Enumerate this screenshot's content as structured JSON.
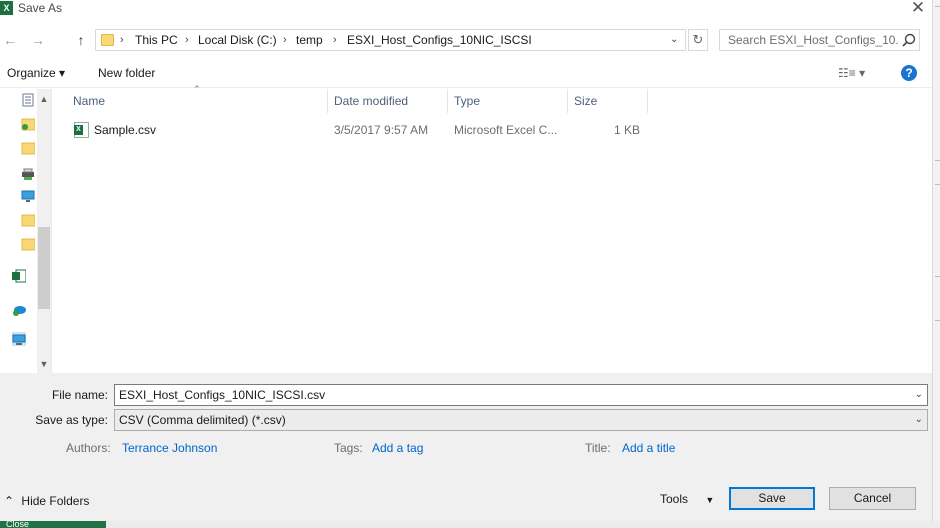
{
  "window": {
    "title": "Save As",
    "app_icon": "excel-icon",
    "close_glyph": "✕"
  },
  "address": {
    "crumbs": [
      "This PC",
      "Local Disk (C:)",
      "temp",
      "ESXI_Host_Configs_10NIC_ISCSI"
    ],
    "separator": "›",
    "dropdown_glyph": "⌄",
    "refresh_glyph": "↻"
  },
  "nav_buttons": {
    "back": "←",
    "forward": "→",
    "up": "↑"
  },
  "search": {
    "placeholder": "Search ESXI_Host_Configs_10..."
  },
  "toolbar": {
    "organize_label": "Organize ▾",
    "new_folder_label": "New folder",
    "view_label": "☷≡  ▾",
    "help_label": "?"
  },
  "columns": {
    "name": "Name",
    "date_modified": "Date modified",
    "type": "Type",
    "size": "Size"
  },
  "files": [
    {
      "name": "Sample.csv",
      "date_modified": "3/5/2017 9:57 AM",
      "type": "Microsoft Excel C...",
      "size": "1 KB"
    }
  ],
  "form": {
    "file_name_label": "File name:",
    "file_name_value": "ESXI_Host_Configs_10NIC_ISCSI.csv",
    "save_as_type_label": "Save as type:",
    "save_as_type_value": "CSV (Comma delimited) (*.csv)",
    "authors_label": "Authors:",
    "authors_value": "Terrance Johnson",
    "tags_label": "Tags:",
    "tags_value": "Add a tag",
    "title_label": "Title:",
    "title_value": "Add a title"
  },
  "footer": {
    "hide_folders_label": "Hide Folders",
    "tools_label": "Tools",
    "save_label": "Save",
    "cancel_label": "Cancel"
  },
  "background": {
    "taskbar_text": "Close"
  },
  "colors": {
    "accent": "#0078d7",
    "link": "#0066cc",
    "excel_green": "#1d6f42",
    "folder_yellow": "#f8d775"
  }
}
